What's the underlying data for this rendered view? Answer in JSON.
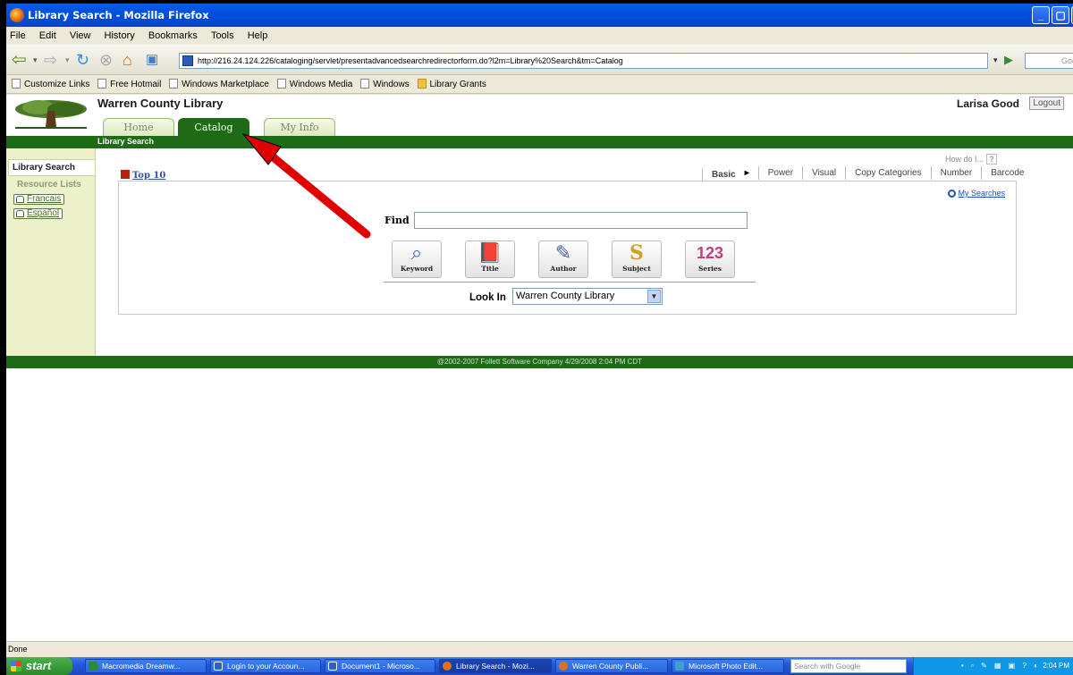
{
  "window": {
    "title": "Library Search - Mozilla Firefox"
  },
  "menu": [
    "File",
    "Edit",
    "View",
    "History",
    "Bookmarks",
    "Tools",
    "Help"
  ],
  "address": {
    "url": "http://216.24.124.226/cataloging/servlet/presentadvancedsearchredirectorform.do?l2m=Library%20Search&tm=Catalog",
    "search_placeholder": "Google"
  },
  "bookmarks": [
    "Customize Links",
    "Free Hotmail",
    "Windows Marketplace",
    "Windows Media",
    "Windows",
    "Library Grants"
  ],
  "site": {
    "library_name": "Warren County Library",
    "user_name": "Larisa Good",
    "logout_label": "Logout",
    "tabs": [
      {
        "label": "Home",
        "active": false
      },
      {
        "label": "Catalog",
        "active": true
      },
      {
        "label": "My Info",
        "active": false
      }
    ],
    "subnav_label": "Library Search",
    "sidebar": {
      "selected": "Library Search",
      "resource_lists": "Resource Lists",
      "languages": [
        "Francais",
        "Español"
      ]
    },
    "how_do_i": "How do I...",
    "help_q": "?",
    "top10": "Top 10",
    "search_tabs": [
      "Basic",
      "Power",
      "Visual",
      "Copy Categories",
      "Number",
      "Barcode"
    ],
    "my_searches": "My Searches",
    "find_label": "Find",
    "find_value": "",
    "search_buttons": [
      {
        "label": "Keyword",
        "icon": "magnifier-icon"
      },
      {
        "label": "Title",
        "icon": "book-icon"
      },
      {
        "label": "Author",
        "icon": "quill-icon"
      },
      {
        "label": "Subject",
        "icon": "subject-icon"
      },
      {
        "label": "Series",
        "icon": "series-icon"
      }
    ],
    "look_in_label": "Look In",
    "look_in_value": "Warren County Library",
    "footer": "@2002-2007 Follett Software Company    4/29/2008 2:04 PM CDT"
  },
  "status_text": "Done",
  "taskbar": {
    "start_label": "start",
    "tasks": [
      {
        "label": "Macromedia Dreamw...",
        "active": false
      },
      {
        "label": "Login to your Accoun...",
        "active": false
      },
      {
        "label": "Document1 - Microso...",
        "active": false
      },
      {
        "label": "Library Search - Mozi...",
        "active": true
      },
      {
        "label": "Warren County Publi...",
        "active": false
      },
      {
        "label": "Microsoft Photo Edit...",
        "active": false
      }
    ],
    "search_placeholder": "Search with Google",
    "clock": "2:04 PM"
  },
  "annotation": {
    "color": "#e00000"
  }
}
